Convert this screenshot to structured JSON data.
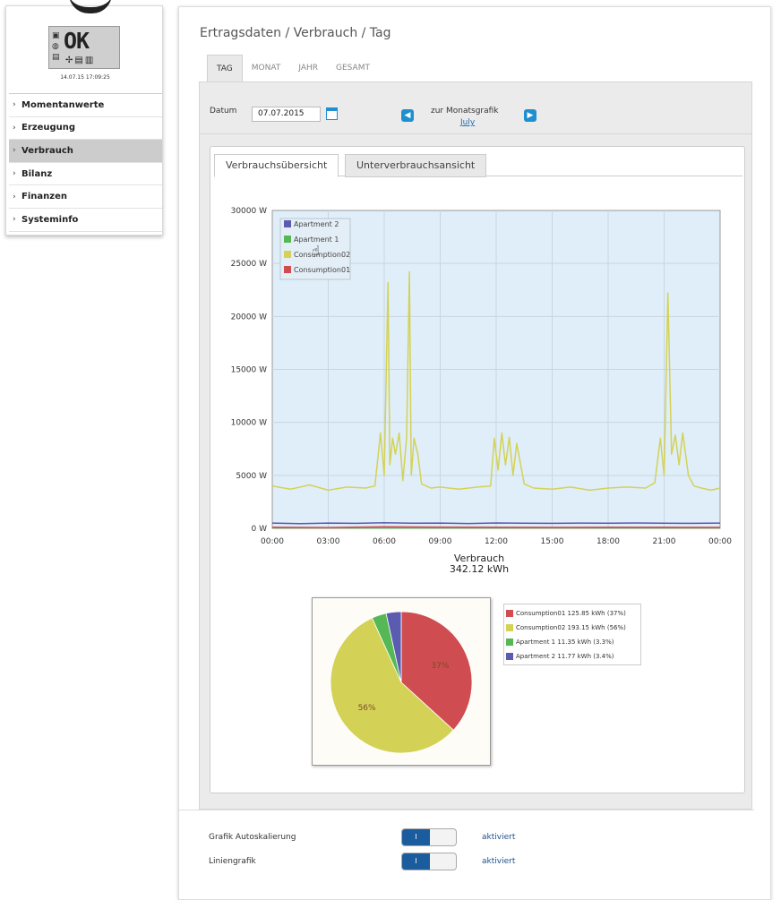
{
  "device": {
    "display_text": "OK",
    "timestamp": "14.07.15 17:09:25"
  },
  "sidebar": {
    "items": [
      {
        "label": "Momentanwerte",
        "active": false
      },
      {
        "label": "Erzeugung",
        "active": false
      },
      {
        "label": "Verbrauch",
        "active": true
      },
      {
        "label": "Bilanz",
        "active": false
      },
      {
        "label": "Finanzen",
        "active": false
      },
      {
        "label": "Systeminfo",
        "active": false
      }
    ]
  },
  "breadcrumb": "Ertragsdaten / Verbrauch / Tag",
  "period_tabs": [
    "TAG",
    "MONAT",
    "JAHR",
    "GESAMT"
  ],
  "active_period_tab": "TAG",
  "date": {
    "label": "Datum",
    "value": "07.07.2015",
    "month_label": "zur Monatsgrafik",
    "month_link": "July"
  },
  "view_tabs": [
    "Verbrauchsübersicht",
    "Unterverbrauchsansicht"
  ],
  "active_view_tab": "Verbrauchsübersicht",
  "chart_data": [
    {
      "type": "line",
      "x_ticks": [
        "00:00",
        "03:00",
        "06:00",
        "09:00",
        "12:00",
        "15:00",
        "18:00",
        "21:00",
        "00:00"
      ],
      "y_ticks": [
        "0 W",
        "5000 W",
        "10000 W",
        "15000 W",
        "20000 W",
        "25000 W",
        "30000 W"
      ],
      "ylim": [
        0,
        30000
      ],
      "xlim_hours": [
        0,
        24
      ],
      "grid": true,
      "legend_position": "top-left",
      "series": [
        {
          "name": "Apartment 2",
          "color": "#5b5bb0",
          "x": [
            0,
            1.5,
            3,
            4.5,
            6,
            7.5,
            9,
            10.5,
            12,
            13.5,
            15,
            16.5,
            18,
            19.5,
            21,
            22.5,
            24
          ],
          "y": [
            500,
            450,
            500,
            470,
            520,
            480,
            500,
            460,
            510,
            490,
            470,
            500,
            480,
            510,
            490,
            470,
            500
          ]
        },
        {
          "name": "Apartment 1",
          "color": "#55b855",
          "x": [
            0,
            6,
            12,
            18,
            24
          ],
          "y": [
            50,
            50,
            50,
            50,
            50
          ]
        },
        {
          "name": "Consumption02",
          "color": "#d4d256",
          "x": [
            0,
            1,
            2,
            3,
            4,
            5,
            5.5,
            5.8,
            6.0,
            6.2,
            6.3,
            6.45,
            6.6,
            6.8,
            7.0,
            7.2,
            7.35,
            7.45,
            7.6,
            7.8,
            8.0,
            8.5,
            9,
            10,
            11,
            11.7,
            11.9,
            12.1,
            12.3,
            12.5,
            12.7,
            12.9,
            13.1,
            13.5,
            14,
            15,
            16,
            17,
            18,
            19,
            20,
            20.5,
            20.8,
            21.0,
            21.2,
            21.4,
            21.6,
            21.8,
            22.0,
            22.3,
            22.6,
            23,
            23.5,
            24
          ],
          "y": [
            4000,
            3700,
            4100,
            3600,
            3900,
            3800,
            4000,
            9000,
            5000,
            23200,
            6000,
            8500,
            7000,
            9000,
            4500,
            8600,
            24200,
            5000,
            8500,
            7000,
            4200,
            3800,
            3900,
            3700,
            3900,
            4000,
            8500,
            5500,
            9000,
            6000,
            8600,
            5000,
            8000,
            4200,
            3800,
            3700,
            3900,
            3600,
            3800,
            3900,
            3800,
            4300,
            8500,
            5000,
            22200,
            7000,
            8800,
            6000,
            9000,
            5000,
            4000,
            3800,
            3600,
            3800
          ]
        },
        {
          "name": "Consumption01",
          "color": "#cf4d50",
          "x": [
            0,
            3,
            6,
            9,
            12,
            15,
            18,
            21,
            24
          ],
          "y": [
            100,
            80,
            150,
            120,
            100,
            90,
            110,
            100,
            90
          ]
        }
      ]
    },
    {
      "type": "pie",
      "title": "Verbrauch",
      "subtitle": "342.12 kWh",
      "legend_position": "right",
      "slices": [
        {
          "name": "Consumption01",
          "value": 125.85,
          "unit": "kWh",
          "percent": 37,
          "pie_label": "37%",
          "legend_text": "Consumption01 125.85 kWh (37%)",
          "color": "#cf4d50"
        },
        {
          "name": "Consumption02",
          "value": 193.15,
          "unit": "kWh",
          "percent": 56,
          "pie_label": "56%",
          "legend_text": "Consumption02 193.15 kWh (56%)",
          "color": "#d4d256"
        },
        {
          "name": "Apartment 1",
          "value": 11.35,
          "unit": "kWh",
          "percent": 3.3,
          "pie_label": "",
          "legend_text": "Apartment 1 11.35 kWh (3.3%)",
          "color": "#55b855"
        },
        {
          "name": "Apartment 2",
          "value": 11.77,
          "unit": "kWh",
          "percent": 3.4,
          "pie_label": "",
          "legend_text": "Apartment 2 11.77 kWh (3.4%)",
          "color": "#5b5bb0"
        }
      ]
    }
  ],
  "settings": [
    {
      "label": "Grafik Autoskalierung",
      "switch_text": "I",
      "state": "aktiviert"
    },
    {
      "label": "Liniengrafik",
      "switch_text": "I",
      "state": "aktiviert"
    }
  ],
  "colors": {
    "accent": "#1f8fd0",
    "chart_background": "#dfeef8",
    "switch_on": "#1a5c9e"
  },
  "icons": {
    "calendar": "calendar-icon",
    "prev": "arrow-left-icon",
    "next": "arrow-right-icon",
    "cursor": "hand-cursor-icon"
  }
}
